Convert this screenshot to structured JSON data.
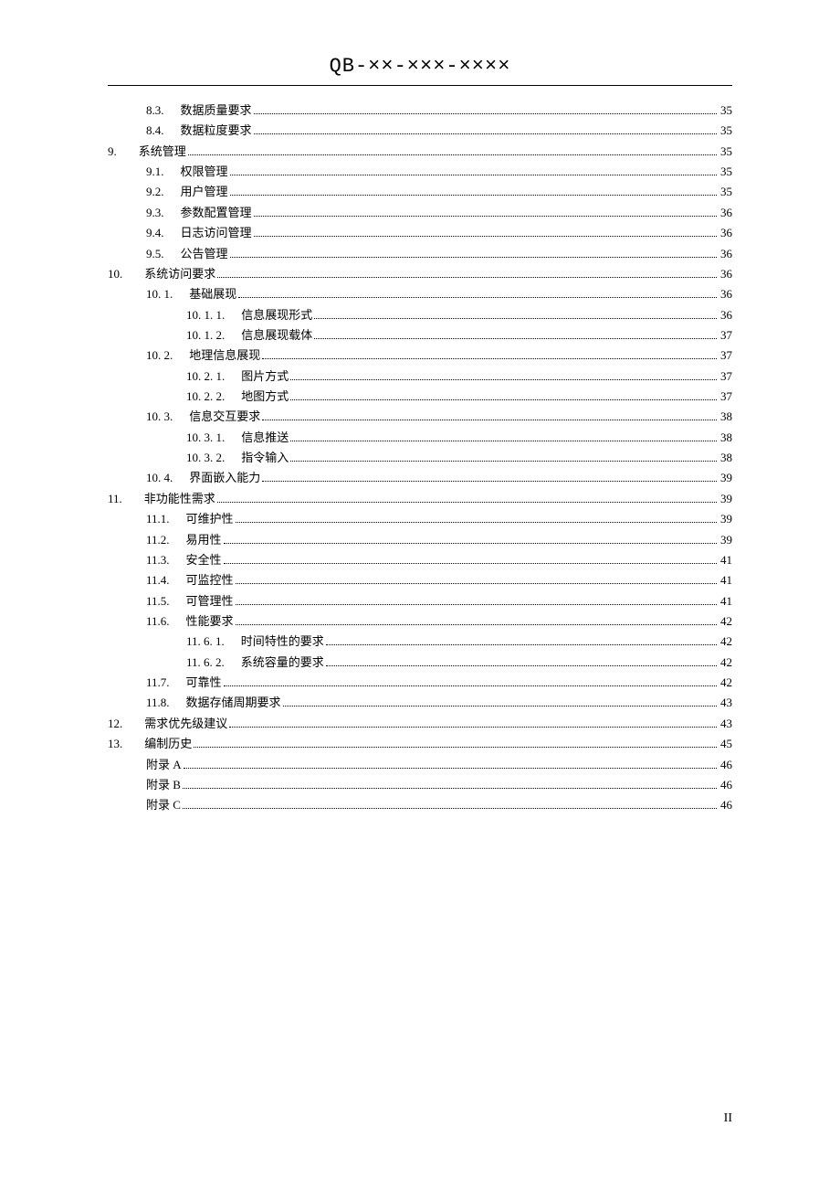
{
  "header": "QB-××-×××-××××",
  "page_number": "II",
  "toc": [
    {
      "level": 1,
      "num": "8.3.",
      "title": "数据质量要求",
      "page": "35"
    },
    {
      "level": 1,
      "num": "8.4.",
      "title": "数据粒度要求",
      "page": "35"
    },
    {
      "level": 0,
      "num": "9.",
      "title": "系统管理",
      "page": "35"
    },
    {
      "level": 1,
      "num": "9.1.",
      "title": "权限管理",
      "page": "35"
    },
    {
      "level": 1,
      "num": "9.2.",
      "title": "用户管理",
      "page": "35"
    },
    {
      "level": 1,
      "num": "9.3.",
      "title": "参数配置管理",
      "page": "36"
    },
    {
      "level": 1,
      "num": "9.4.",
      "title": "日志访问管理",
      "page": "36"
    },
    {
      "level": 1,
      "num": "9.5.",
      "title": "公告管理",
      "page": "36"
    },
    {
      "level": 0,
      "num": "10.",
      "title": "系统访问要求",
      "page": "36"
    },
    {
      "level": 1,
      "num": "10. 1.",
      "title": "基础展现",
      "page": "36"
    },
    {
      "level": 2,
      "num": "10. 1. 1.",
      "title": "信息展现形式",
      "page": "36"
    },
    {
      "level": 2,
      "num": "10. 1. 2.",
      "title": "信息展现载体",
      "page": "37"
    },
    {
      "level": 1,
      "num": "10. 2.",
      "title": "地理信息展现",
      "page": "37"
    },
    {
      "level": 2,
      "num": "10. 2. 1.",
      "title": "图片方式",
      "page": "37"
    },
    {
      "level": 2,
      "num": "10. 2. 2.",
      "title": "地图方式",
      "page": "37"
    },
    {
      "level": 1,
      "num": "10. 3.",
      "title": "信息交互要求",
      "page": "38"
    },
    {
      "level": 2,
      "num": "10. 3. 1.",
      "title": "信息推送",
      "page": "38"
    },
    {
      "level": 2,
      "num": "10. 3. 2.",
      "title": "指令输入",
      "page": "38"
    },
    {
      "level": 1,
      "num": "10. 4.",
      "title": "界面嵌入能力",
      "page": "39"
    },
    {
      "level": 0,
      "num": "11.",
      "title": "非功能性需求",
      "page": "39"
    },
    {
      "level": 1,
      "num": "11.1.",
      "title": "可维护性",
      "page": "39"
    },
    {
      "level": 1,
      "num": "11.2.",
      "title": "易用性",
      "page": "39"
    },
    {
      "level": 1,
      "num": "11.3.",
      "title": "安全性",
      "page": "41"
    },
    {
      "level": 1,
      "num": "11.4.",
      "title": "可监控性",
      "page": "41"
    },
    {
      "level": 1,
      "num": "11.5.",
      "title": "可管理性",
      "page": "41"
    },
    {
      "level": 1,
      "num": "11.6.",
      "title": "性能要求",
      "page": "42"
    },
    {
      "level": 2,
      "num": "11. 6. 1.",
      "title": "时间特性的要求",
      "page": "42"
    },
    {
      "level": 2,
      "num": "11. 6. 2.",
      "title": "系统容量的要求",
      "page": "42"
    },
    {
      "level": 1,
      "num": "11.7.",
      "title": "可靠性",
      "page": "42"
    },
    {
      "level": 1,
      "num": "11.8.",
      "title": "数据存储周期要求",
      "page": "43"
    },
    {
      "level": 0,
      "num": "12.",
      "title": "需求优先级建议",
      "page": "43"
    },
    {
      "level": 0,
      "num": "13.",
      "title": "编制历史",
      "page": "45"
    },
    {
      "level": 1,
      "num": "",
      "title": "附录 A",
      "page": "46"
    },
    {
      "level": 1,
      "num": "",
      "title": "附录 B",
      "page": "46"
    },
    {
      "level": 1,
      "num": "",
      "title": "附录 C",
      "page": "46"
    }
  ]
}
